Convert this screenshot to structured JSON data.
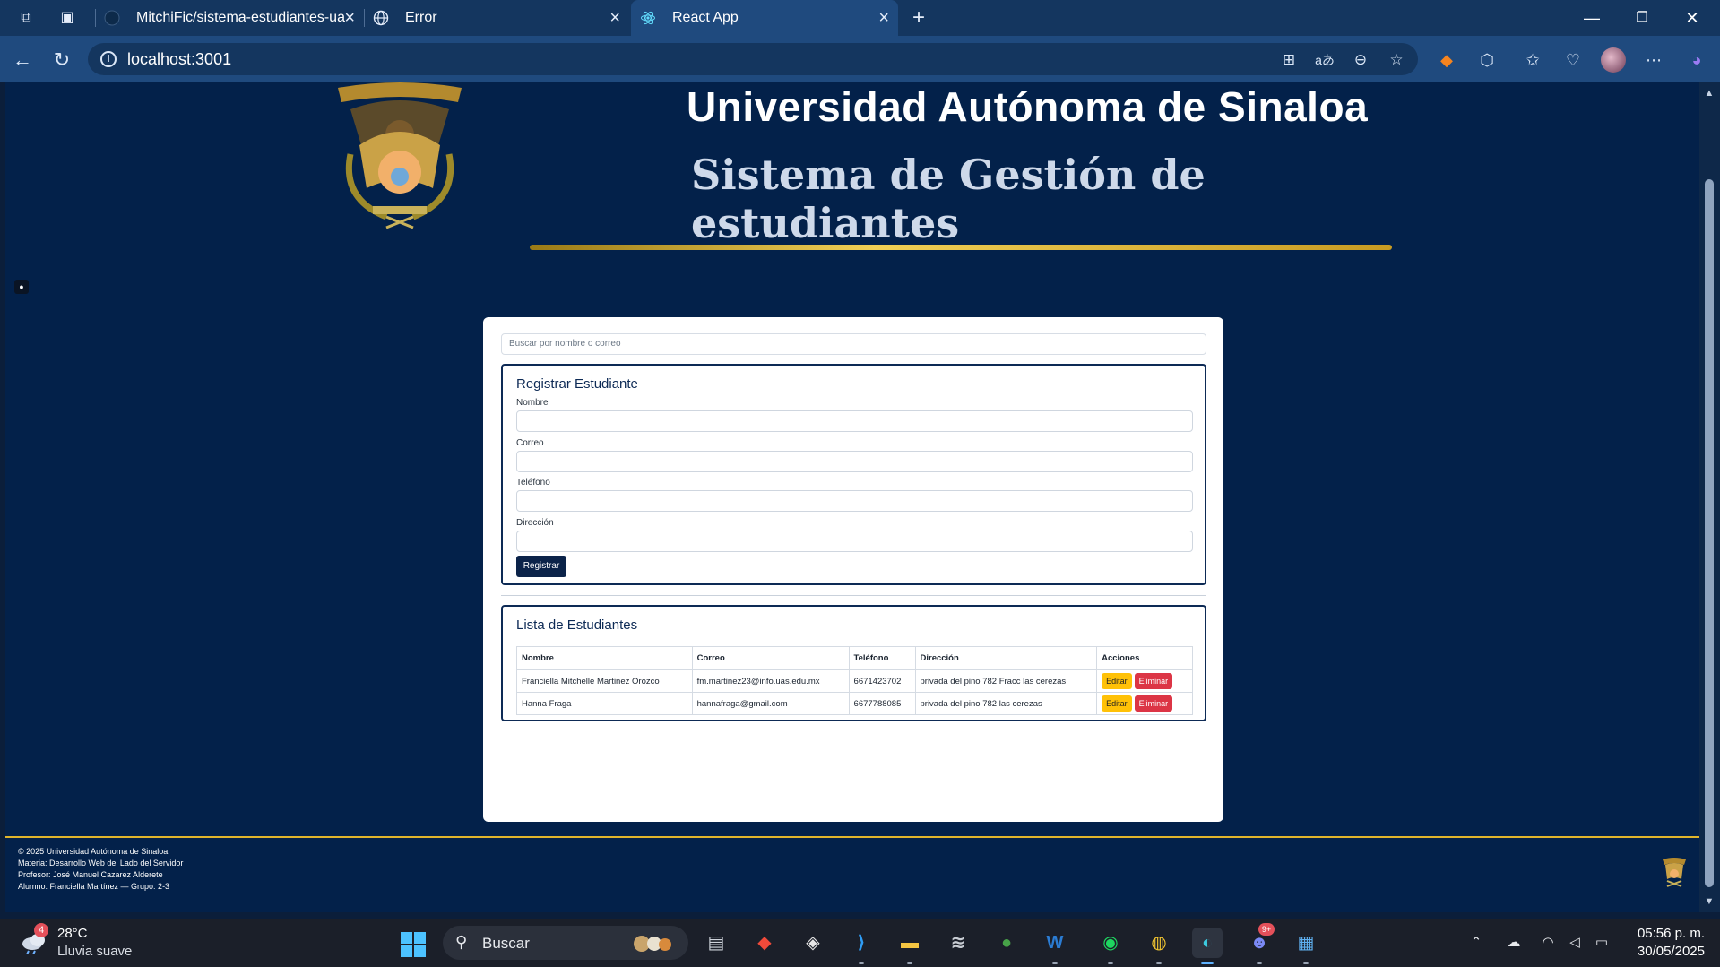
{
  "browser": {
    "tabs": [
      {
        "label": "MitchiFic/sistema-estudiantes-ua",
        "icon": "github-icon",
        "active": false
      },
      {
        "label": "Error",
        "icon": "globe-icon",
        "active": false
      },
      {
        "label": "React App",
        "icon": "react-icon",
        "active": true
      }
    ],
    "url": "localhost:3001"
  },
  "header": {
    "university": "Universidad Autónoma de Sinaloa",
    "system": "Sistema de Gestión de estudiantes"
  },
  "search": {
    "placeholder": "Buscar por nombre o correo"
  },
  "register": {
    "title": "Registrar Estudiante",
    "fields": [
      {
        "label": "Nombre",
        "value": ""
      },
      {
        "label": "Correo",
        "value": ""
      },
      {
        "label": "Teléfono",
        "value": ""
      },
      {
        "label": "Dirección",
        "value": ""
      }
    ],
    "submit_label": "Registrar"
  },
  "list": {
    "title": "Lista de Estudiantes",
    "columns": [
      "Nombre",
      "Correo",
      "Teléfono",
      "Dirección",
      "Acciones"
    ],
    "rows": [
      {
        "nombre": "Franciella Mitchelle Martinez Orozco",
        "correo": "fm.martinez23@info.uas.edu.mx",
        "telefono": "6671423702",
        "direccion": "privada del pino 782 Fracc las cerezas"
      },
      {
        "nombre": "Hanna Fraga",
        "correo": "hannafraga@gmail.com",
        "telefono": "6677788085",
        "direccion": "privada del pino 782 las cerezas"
      }
    ],
    "edit_label": "Editar",
    "delete_label": "Eliminar"
  },
  "footer": {
    "lines": [
      "© 2025 Universidad Autónoma de Sinaloa",
      "Materia: Desarrollo Web del Lado del Servidor",
      "Profesor: José Manuel Cazarez Alderete",
      "Alumno: Franciella Martínez — Grupo: 2-3"
    ]
  },
  "taskbar": {
    "weather_temp": "28°C",
    "weather_desc": "Lluvia suave",
    "weather_badge": "4",
    "search_label": "Buscar",
    "discord_badge": "9+",
    "time": "05:56 p. m.",
    "date": "30/05/2025"
  },
  "colors": {
    "page_bg": "#03214a",
    "accent_gold": "#e0b52b",
    "primary_button": "#0b2349",
    "edit_button": "#ffc107",
    "delete_button": "#dc3545"
  }
}
